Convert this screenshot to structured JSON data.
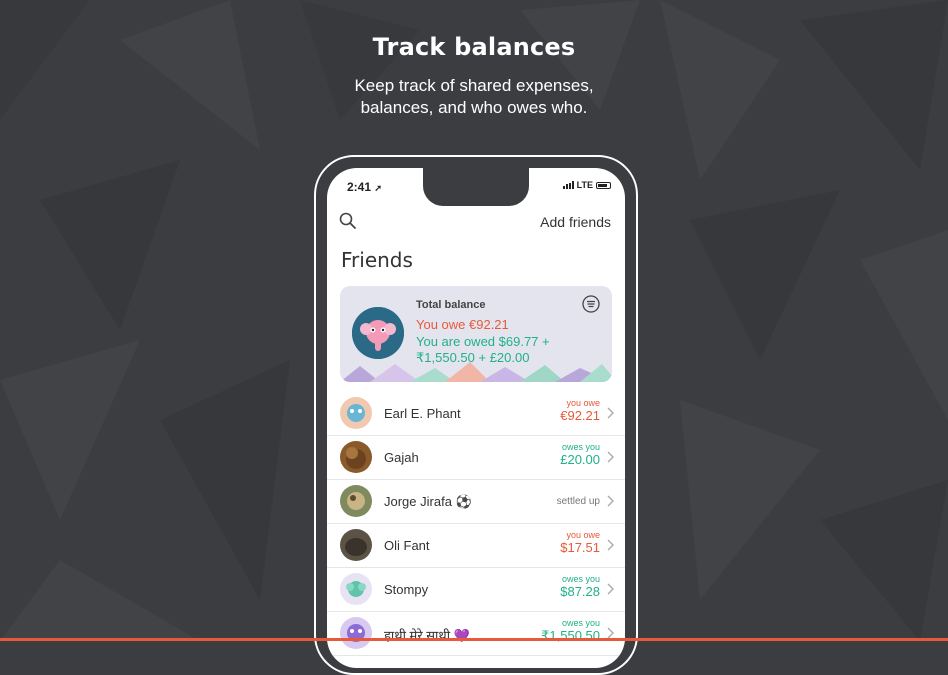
{
  "hero": {
    "title": "Track balances",
    "subtitle_line1": "Keep track of shared expenses,",
    "subtitle_line2": "balances, and who owes who."
  },
  "status_bar": {
    "time": "2:41",
    "network": "LTE"
  },
  "header": {
    "search_icon": "search-icon",
    "add_friends_label": "Add friends"
  },
  "page_title": "Friends",
  "balance_card": {
    "label": "Total balance",
    "you_owe": "You owe €92.21",
    "you_are_owed_line1": "You are owed $69.77 +",
    "you_are_owed_line2": "₹1,550.50 + £20.00"
  },
  "friends": [
    {
      "name": "Earl E. Phant",
      "status": "owe",
      "status_label": "you owe",
      "amount": "€92.21"
    },
    {
      "name": "Gajah",
      "status": "owed",
      "status_label": "owes you",
      "amount": "£20.00"
    },
    {
      "name": "Jorge Jirafa ⚽",
      "status": "settled",
      "status_label": "settled up",
      "amount": ""
    },
    {
      "name": "Oli Fant",
      "status": "owe",
      "status_label": "you owe",
      "amount": "$17.51"
    },
    {
      "name": "Stompy",
      "status": "owed",
      "status_label": "owes you",
      "amount": "$87.28"
    },
    {
      "name": "हाथी मेरे साथी 💜",
      "status": "owed",
      "status_label": "owes you",
      "amount": "₹1,550.50"
    }
  ],
  "colors": {
    "background": "#3b3d41",
    "owe": "#e8593a",
    "owed": "#21b08a",
    "card_bg": "#e3e4ee"
  }
}
